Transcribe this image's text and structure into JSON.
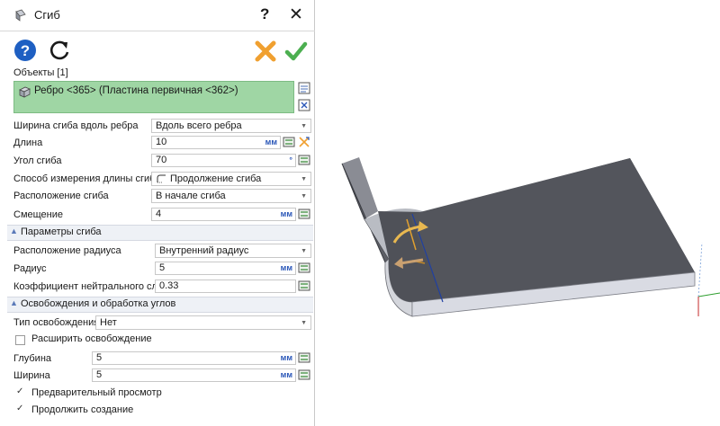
{
  "dialog": {
    "title": "Сгиб",
    "help_glyph": "?",
    "close_glyph": "✕",
    "icons": [
      "help-icon",
      "refresh-icon",
      "cancel-icon",
      "ok-icon"
    ],
    "accent_colors": {
      "selection_bg": "#9fd6a4",
      "unit": "#2b57b8",
      "cancel": "#f0a030",
      "ok": "#4caf50"
    }
  },
  "objects": {
    "label": "Объекты [1]",
    "item": "Ребро <365> (Пластина первичная <362>)"
  },
  "params": {
    "bend_width": {
      "label": "Ширина сгиба вдоль ребра",
      "value": "Вдоль всего ребра"
    },
    "length": {
      "label": "Длина",
      "value": "10",
      "unit": "мм"
    },
    "angle": {
      "label": "Угол сгиба",
      "value": "70",
      "unit": "°"
    },
    "measure_method": {
      "label": "Способ измерения длины сгиба",
      "value": "Продолжение сгиба"
    },
    "bend_position": {
      "label": "Расположение сгиба",
      "value": "В начале сгиба"
    },
    "offset": {
      "label": "Смещение",
      "value": "4",
      "unit": "мм"
    }
  },
  "bend_params": {
    "title": "Параметры сгиба",
    "radius_position": {
      "label": "Расположение радиуса",
      "value": "Внутренний радиус"
    },
    "radius": {
      "label": "Радиус",
      "value": "5",
      "unit": "мм"
    },
    "k_factor": {
      "label": "Коэффициент нейтрального слоя",
      "value": "0.33"
    }
  },
  "relief": {
    "title": "Освобождения и обработка углов",
    "type": {
      "label": "Тип освобождения",
      "value": "Нет"
    },
    "expand": {
      "label": "Расширить освобождение",
      "checked": false
    },
    "depth": {
      "label": "Глубина",
      "value": "5",
      "unit": "мм"
    },
    "width": {
      "label": "Ширина",
      "value": "5",
      "unit": "мм"
    }
  },
  "options": {
    "preview": {
      "label": "Предварительный просмотр",
      "checked": true
    },
    "continue": {
      "label": "Продолжить создание",
      "checked": true
    }
  }
}
